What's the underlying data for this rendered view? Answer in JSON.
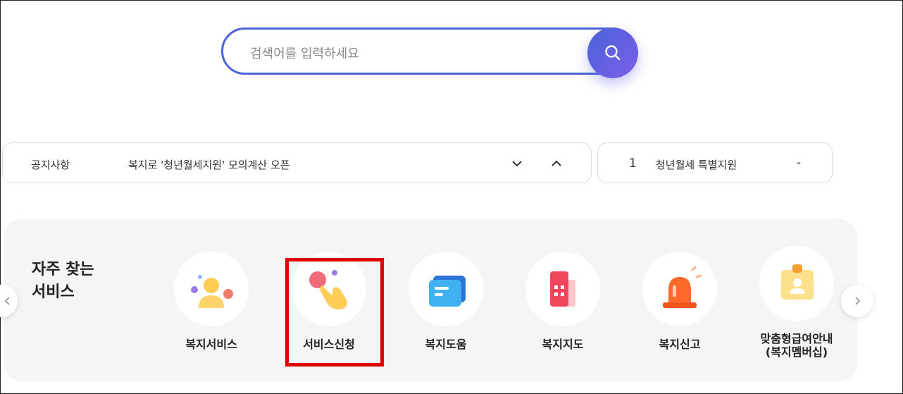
{
  "search": {
    "placeholder": "검색어를 입력하세요",
    "value": ""
  },
  "notice": {
    "label": "공지사항",
    "text": "복지로 '청년월세지원' 모의계산 오픈"
  },
  "ranking": {
    "number": "1",
    "text": "청년월세 특별지원",
    "dash": "-"
  },
  "services": {
    "title": "자주 찾는\n서비스",
    "items": [
      {
        "label": "복지서비스",
        "icon": "person-icon"
      },
      {
        "label": "서비스신청",
        "icon": "hand-tap-icon"
      },
      {
        "label": "복지도움",
        "icon": "chat-bubble-icon"
      },
      {
        "label": "복지지도",
        "icon": "map-building-icon"
      },
      {
        "label": "복지신고",
        "icon": "siren-icon"
      },
      {
        "label": "맞춤형급여안내\n(복지멤버십)",
        "icon": "id-badge-icon"
      }
    ]
  },
  "colors": {
    "accent": "#4a63d8",
    "highlight": "#e00000"
  }
}
